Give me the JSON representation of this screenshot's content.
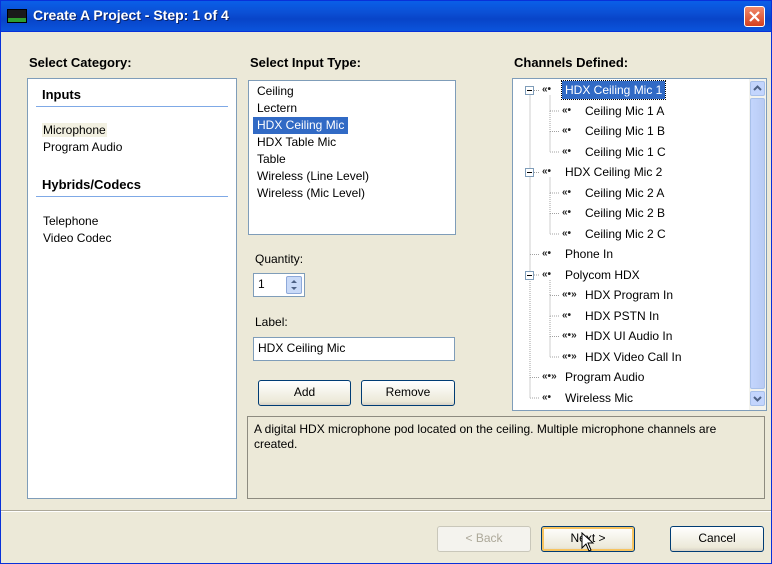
{
  "window": {
    "title": "Create A Project - Step: 1 of 4"
  },
  "category": {
    "header": "Select Category:",
    "groups": [
      {
        "title": "Inputs",
        "items": [
          "Microphone",
          "Program Audio"
        ]
      },
      {
        "title": "Hybrids/Codecs",
        "items": [
          "Telephone",
          "Video Codec"
        ]
      }
    ],
    "selected": "Microphone"
  },
  "input_type": {
    "header": "Select Input Type:",
    "items": [
      "Ceiling",
      "Lectern",
      "HDX Ceiling Mic",
      "HDX Table Mic",
      "Table",
      "Wireless (Line Level)",
      "Wireless (Mic Level)"
    ],
    "selected": "HDX Ceiling Mic"
  },
  "quantity": {
    "label": "Quantity:",
    "value": "1"
  },
  "label_field": {
    "label": "Label:",
    "value": "HDX Ceiling Mic"
  },
  "buttons": {
    "add": "Add",
    "remove": "Remove",
    "back": "< Back",
    "next": "Next >",
    "cancel": "Cancel"
  },
  "channels": {
    "header": "Channels Defined:",
    "selected": "HDX Ceiling Mic 1",
    "tree": [
      {
        "level": 0,
        "label": "HDX Ceiling Mic 1",
        "icon": "«•",
        "expandable": true,
        "selected": true
      },
      {
        "level": 1,
        "label": "Ceiling Mic 1 A",
        "icon": "«•"
      },
      {
        "level": 1,
        "label": "Ceiling Mic 1 B",
        "icon": "«•"
      },
      {
        "level": 1,
        "label": "Ceiling Mic 1 C",
        "icon": "«•"
      },
      {
        "level": 0,
        "label": "HDX Ceiling Mic 2",
        "icon": "«•",
        "expandable": true
      },
      {
        "level": 1,
        "label": "Ceiling Mic 2 A",
        "icon": "«•"
      },
      {
        "level": 1,
        "label": "Ceiling Mic 2 B",
        "icon": "«•"
      },
      {
        "level": 1,
        "label": "Ceiling Mic 2 C",
        "icon": "«•"
      },
      {
        "level": 0,
        "label": "Phone In",
        "icon": "«•"
      },
      {
        "level": 0,
        "label": "Polycom HDX",
        "icon": "«•",
        "expandable": true
      },
      {
        "level": 1,
        "label": "HDX Program In",
        "icon": "«•»"
      },
      {
        "level": 1,
        "label": "HDX PSTN In",
        "icon": "«•"
      },
      {
        "level": 1,
        "label": "HDX UI Audio In",
        "icon": "«•»"
      },
      {
        "level": 1,
        "label": "HDX Video Call In",
        "icon": "«•»"
      },
      {
        "level": 0,
        "label": "Program Audio",
        "icon": "«•»"
      },
      {
        "level": 0,
        "label": "Wireless Mic",
        "icon": "«•"
      }
    ]
  },
  "description": "A digital HDX microphone pod located on the ceiling.  Multiple microphone channels are created.",
  "colors": {
    "title_bar": "#0a54dc",
    "selection": "#316ac5",
    "close_button": "#d5401f",
    "dialog_face": "#ece9d8"
  }
}
